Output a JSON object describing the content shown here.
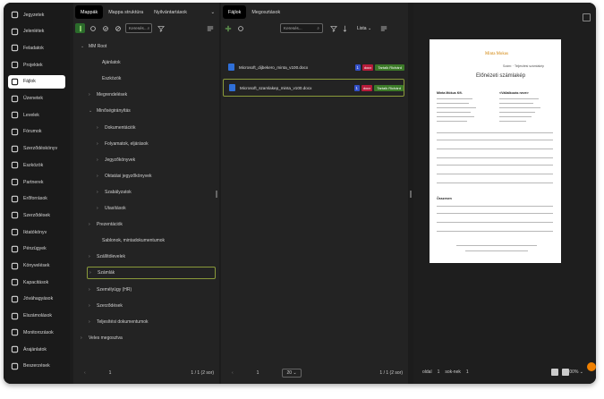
{
  "sidebar": {
    "items": [
      {
        "label": "Jegyzetek",
        "icon": "notes-icon"
      },
      {
        "label": "Jelenlétek",
        "icon": "clock-icon"
      },
      {
        "label": "Feladatok",
        "icon": "check-icon"
      },
      {
        "label": "Projektek",
        "icon": "folder-icon"
      },
      {
        "label": "Fájlok",
        "icon": "file-icon",
        "active": true
      },
      {
        "label": "Üzenetek",
        "icon": "message-icon"
      },
      {
        "label": "Levelek",
        "icon": "mail-icon"
      },
      {
        "label": "Fórumok",
        "icon": "forum-icon"
      },
      {
        "label": "Szerződéskönyv",
        "icon": "book-icon"
      },
      {
        "label": "Eszközök",
        "icon": "tool-icon"
      },
      {
        "label": "Partnerek",
        "icon": "partner-icon"
      },
      {
        "label": "Erőforrások",
        "icon": "resource-icon"
      },
      {
        "label": "Szerződések",
        "icon": "gavel-icon"
      },
      {
        "label": "Iktatókönyv",
        "icon": "register-icon"
      },
      {
        "label": "Pénzügyek",
        "icon": "money-icon"
      },
      {
        "label": "Könyvelések",
        "icon": "ledger-icon"
      },
      {
        "label": "Kapacitások",
        "icon": "capacity-icon"
      },
      {
        "label": "Jóváhagyások",
        "icon": "approve-icon"
      },
      {
        "label": "Elszámolások",
        "icon": "billing-icon"
      },
      {
        "label": "Monitorozások",
        "icon": "monitor-icon"
      },
      {
        "label": "Árajánlatok",
        "icon": "quote-icon"
      },
      {
        "label": "Beszerzések",
        "icon": "cart-icon"
      }
    ]
  },
  "folders_panel": {
    "tabs": [
      "Mappák",
      "Mappa struktúra",
      "Nyilvántartások"
    ],
    "search_placeholder": "Keresés...",
    "tree": [
      {
        "label": "MM Root",
        "chev": "⌄",
        "level": 0
      },
      {
        "label": "Ajánlatok",
        "chev": "",
        "level": 1
      },
      {
        "label": "Eszközök",
        "chev": "",
        "level": 1
      },
      {
        "label": "Megrendelések",
        "chev": "›",
        "level": 1
      },
      {
        "label": "Minőségirányítás",
        "chev": "⌄",
        "level": 1
      },
      {
        "label": "Dokumentációk",
        "chev": "›",
        "level": 2
      },
      {
        "label": "Folyamatok, eljárások",
        "chev": "›",
        "level": 2
      },
      {
        "label": "Jegyzőkönyvek",
        "chev": "›",
        "level": 2
      },
      {
        "label": "Oktatási jegyzőkönyvek",
        "chev": "›",
        "level": 2
      },
      {
        "label": "Szabályzatok",
        "chev": "›",
        "level": 2
      },
      {
        "label": "Utasítások",
        "chev": "›",
        "level": 2
      },
      {
        "label": "Prezentációk",
        "chev": "›",
        "level": 1
      },
      {
        "label": "Sablonok, mintadokumentumok",
        "chev": "",
        "level": 1
      },
      {
        "label": "Szállítólevelek",
        "chev": "›",
        "level": 1
      },
      {
        "label": "Számlák",
        "chev": "›",
        "level": 1,
        "selected": true
      },
      {
        "label": "Személyügy (HR)",
        "chev": "›",
        "level": 1
      },
      {
        "label": "Szerződések",
        "chev": "›",
        "level": 1
      },
      {
        "label": "Teljesítési dokumentumok",
        "chev": "›",
        "level": 1
      },
      {
        "label": "Veles megosztva",
        "chev": "›",
        "level": 0
      }
    ],
    "page": "1",
    "page_info": "1 / 1 (2 sor)"
  },
  "files_panel": {
    "tabs": [
      "Fájlok",
      "Megosztások"
    ],
    "search_placeholder": "Keresés...",
    "view_label": "Lista",
    "files": [
      {
        "name": "Microsoft_dijbekero_minta_v100.docx",
        "count": "1",
        "ext": "docx",
        "action": "Tartalk Richárd"
      },
      {
        "name": "Microsoft_szamlakep_minta_v100.docx",
        "count": "1",
        "ext": "docx",
        "action": "Tartalk Richárd",
        "selected": true
      }
    ],
    "page": "1",
    "page_size": "20",
    "page_info": "1 / 1 (2 sor)"
  },
  "preview": {
    "doc_brand": "Minta Mokus",
    "doc_title": "Előnézeti számlakép",
    "doc_right_header": "Szám: · Teljesítési számlakép",
    "seller": "Minta Mókus Kft.",
    "buyer": "<Vállalkozás neve>",
    "total_label": "Összesen",
    "page_label": "oldal",
    "page_num": "1",
    "page_sep": "sok-nek",
    "page_total": "1",
    "zoom": "100%"
  }
}
